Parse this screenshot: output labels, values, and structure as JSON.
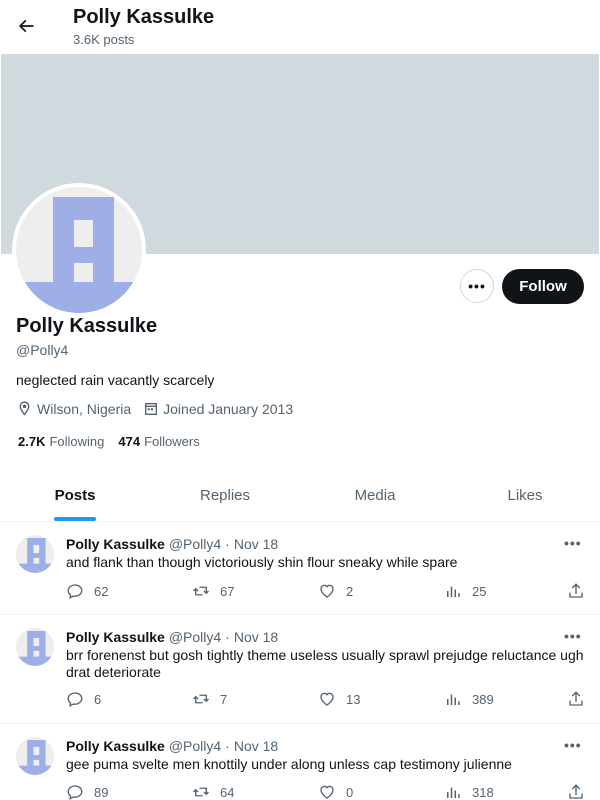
{
  "header": {
    "title": "Polly Kassulke",
    "subtitle": "3.6K posts"
  },
  "profile": {
    "name": "Polly Kassulke",
    "handle": "@Polly4",
    "bio": "neglected rain vacantly scarcely",
    "location": "Wilson, Nigeria",
    "joined": "Joined January 2013",
    "following_count": "2.7K",
    "following_label": "Following",
    "followers_count": "474",
    "followers_label": "Followers",
    "follow_label": "Follow",
    "more_label": "•••"
  },
  "tabs": [
    {
      "label": "Posts"
    },
    {
      "label": "Replies"
    },
    {
      "label": "Media"
    },
    {
      "label": "Likes"
    }
  ],
  "posts": [
    {
      "name": "Polly Kassulke",
      "handle": "@Polly4",
      "date": "Nov 18",
      "text": "and flank than though victoriously shin flour sneaky while spare",
      "replies": "62",
      "reposts": "67",
      "likes": "2",
      "views": "25"
    },
    {
      "name": "Polly Kassulke",
      "handle": "@Polly4",
      "date": "Nov 18",
      "text": "brr forenenst but gosh tightly theme useless usually sprawl prejudge reluctance ugh drat deteriorate",
      "replies": "6",
      "reposts": "7",
      "likes": "13",
      "views": "389"
    },
    {
      "name": "Polly Kassulke",
      "handle": "@Polly4",
      "date": "Nov 18",
      "text": "gee puma svelte men knottily under along unless cap testimony julienne",
      "replies": "89",
      "reposts": "64",
      "likes": "0",
      "views": "318"
    }
  ],
  "colors": {
    "accent": "#1d9bf0",
    "banner": "#cfd9de",
    "avatar_mark": "#9eaee6",
    "avatar_bg": "#eeeeee"
  },
  "icons": [
    "back-arrow-icon",
    "location-icon",
    "calendar-icon",
    "reply-icon",
    "repost-icon",
    "like-icon",
    "views-icon",
    "share-icon"
  ]
}
